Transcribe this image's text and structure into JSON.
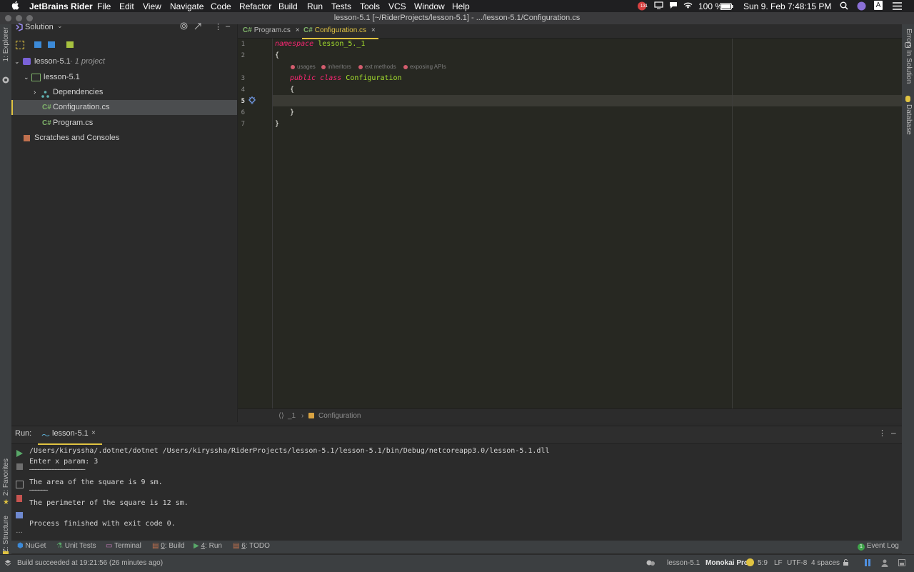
{
  "menubar": {
    "app": "JetBrains Rider",
    "items": [
      "File",
      "Edit",
      "View",
      "Navigate",
      "Code",
      "Refactor",
      "Build",
      "Run",
      "Tests",
      "Tools",
      "VCS",
      "Window",
      "Help"
    ],
    "badge": "131",
    "battery": "100 %",
    "clock": "Sun 9. Feb  7:48:15 PM"
  },
  "window": {
    "title": "lesson-5.1 [~/RiderProjects/lesson-5.1] - .../lesson-5.1/Configuration.cs"
  },
  "left_strip": {
    "explorer": "1: Explorer",
    "favorites": "2: Favorites",
    "structure": "Z: Structure"
  },
  "right_strip": {
    "errors": "Errors In Solution",
    "database": "Database"
  },
  "project": {
    "header": "Solution",
    "tree": [
      {
        "label": "lesson-5.1",
        "suffix": " · 1 project"
      },
      {
        "label": "lesson-5.1"
      },
      {
        "label": "Dependencies"
      },
      {
        "label": "Configuration.cs"
      },
      {
        "label": "Program.cs"
      },
      {
        "label": "Scratches and Consoles"
      }
    ]
  },
  "editor": {
    "tabs": [
      {
        "lang": "C#",
        "label": "Program.cs"
      },
      {
        "lang": "C#",
        "label": "Configuration.cs"
      }
    ],
    "line_numbers": [
      "1",
      "2",
      "3",
      "4",
      "5",
      "6",
      "7"
    ],
    "code": {
      "ns_kw": "namespace",
      "ns_name": "lesson_5._1",
      "open_brace": "{",
      "public_kw": "public",
      "class_kw": "class",
      "class_name": "Configuration",
      "inner_open": "{",
      "inner_close": "}",
      "close_brace": "}"
    },
    "hints": [
      "usages",
      "inheritors",
      "ext methods",
      "exposing APIs"
    ],
    "breadcrumb": {
      "ns": "_1",
      "cls": "Configuration"
    }
  },
  "run": {
    "label": "Run:",
    "tab": "lesson-5.1",
    "output": [
      "/Users/kiryssha/.dotnet/dotnet /Users/kiryssha/RiderProjects/lesson-5.1/lesson-5.1/bin/Debug/netcoreapp3.0/lesson-5.1.dll",
      "Enter x param: 3",
      "———————————————————",
      "The area of the square is 9 sm.",
      "——————",
      "The perimeter of the square is 12 sm.",
      "",
      "Process finished with exit code 0."
    ]
  },
  "toolwindows": {
    "nuget": "NuGet",
    "unit_tests": "Unit Tests",
    "terminal": "Terminal",
    "build_num": "0",
    "build": ": Build",
    "run_num": "4",
    "run": ": Run",
    "todo_num": "6",
    "todo": ": TODO",
    "event_log": "Event Log",
    "event_count": "1"
  },
  "status": {
    "message": "Build succeeded at 19:21:56 (26 minutes ago)",
    "project": "lesson-5.1",
    "theme": "Monokai Pro",
    "position": "5:9",
    "line_sep": "LF",
    "encoding": "UTF-8",
    "indent": "4 spaces"
  },
  "colors": {
    "accent": "#e0c341",
    "editor_bg": "#272822",
    "keyword": "#f92672",
    "class_name": "#a6e22e"
  }
}
